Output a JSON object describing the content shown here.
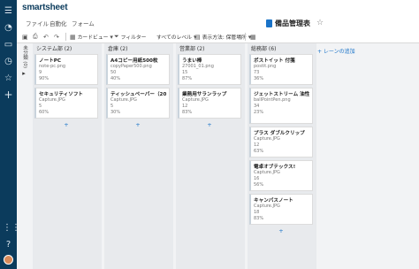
{
  "app": {
    "logo": "smartsheet"
  },
  "menu": [
    "ファイル",
    "自動化",
    "フォーム"
  ],
  "sheet": {
    "title": "備品管理表"
  },
  "toolbar": {
    "card_view": "カードビュー",
    "filter": "フィルター",
    "all_levels": "すべてのレベル",
    "display_method": "表示方法: 保管場所"
  },
  "board": {
    "collapsed_lane": "未分類 (0)",
    "add_lane": "+ レーンの追加",
    "add_card": "+",
    "lanes": [
      {
        "title": "システム部 (2)",
        "cards": [
          {
            "title": "ノートPC",
            "lines": [
              "note-pc.png",
              "9",
              "90%"
            ]
          },
          {
            "title": "セキュリティソフト",
            "lines": [
              "Capture.JPG",
              "5",
              "60%"
            ]
          }
        ]
      },
      {
        "title": "倉庫 (2)",
        "cards": [
          {
            "title": "A4コピー用紙500枚",
            "lines": [
              "copyPaper500.png",
              "50",
              "40%"
            ]
          },
          {
            "title": "ティッシュペーパー（200組…",
            "lines": [
              "Capture.JPG",
              "5",
              "30%"
            ]
          }
        ]
      },
      {
        "title": "営業部 (2)",
        "cards": [
          {
            "title": "うまい棒",
            "lines": [
              "27001_01.png",
              "15",
              "87%"
            ]
          },
          {
            "title": "業務用サランラップ",
            "lines": [
              "Capture.JPG",
              "12",
              "83%"
            ]
          }
        ]
      },
      {
        "title": "総務部 (6)",
        "cards": [
          {
            "title": "ポストイット 付箋",
            "lines": [
              "postit.png",
              "73",
              "36%"
            ]
          },
          {
            "title": "ジェットストリーム 油性ボールペン",
            "lines": [
              "ballPointPen.png",
              "34",
              "23%"
            ]
          },
          {
            "title": "プラス ダブルクリップ",
            "lines": [
              "Capture.JPG",
              "12",
              "63%"
            ]
          },
          {
            "title": "電卓オブテックス!",
            "lines": [
              "Capture.JPG",
              "16",
              "56%"
            ]
          },
          {
            "title": "キャンパスノート",
            "lines": [
              "Capture.JPG",
              "18",
              "83%"
            ]
          }
        ]
      }
    ]
  }
}
